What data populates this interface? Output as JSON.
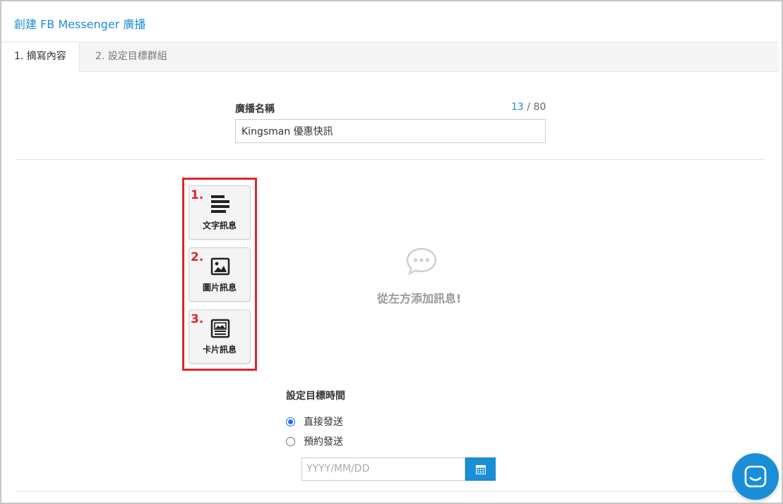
{
  "header": {
    "title": "創建 FB Messenger 廣播"
  },
  "tabs": [
    {
      "label": "1. 摘寫內容",
      "active": true
    },
    {
      "label": "2. 設定目標群組",
      "active": false
    }
  ],
  "broadcast_name": {
    "label": "廣播名稱",
    "count_current": "13",
    "count_max": " / 80",
    "value": "Kingsman 優惠快訊"
  },
  "message_types": [
    {
      "step": "1.",
      "label": "文字訊息",
      "icon": "text-lines-icon"
    },
    {
      "step": "2.",
      "label": "圖片訊息",
      "icon": "image-icon"
    },
    {
      "step": "3.",
      "label": "卡片訊息",
      "icon": "card-icon"
    }
  ],
  "empty_state": {
    "text": "從左方添加訊息!",
    "icon": "chat-bubble-icon"
  },
  "schedule": {
    "title": "設定目標時間",
    "options": [
      {
        "label": "直接發送",
        "checked": true
      },
      {
        "label": "預約發送",
        "checked": false
      }
    ],
    "date_placeholder": "YYYY/MM/DD"
  },
  "colors": {
    "accent": "#1a8ed6",
    "highlight": "#e0262c",
    "radio_checked": "#1a73e8"
  }
}
